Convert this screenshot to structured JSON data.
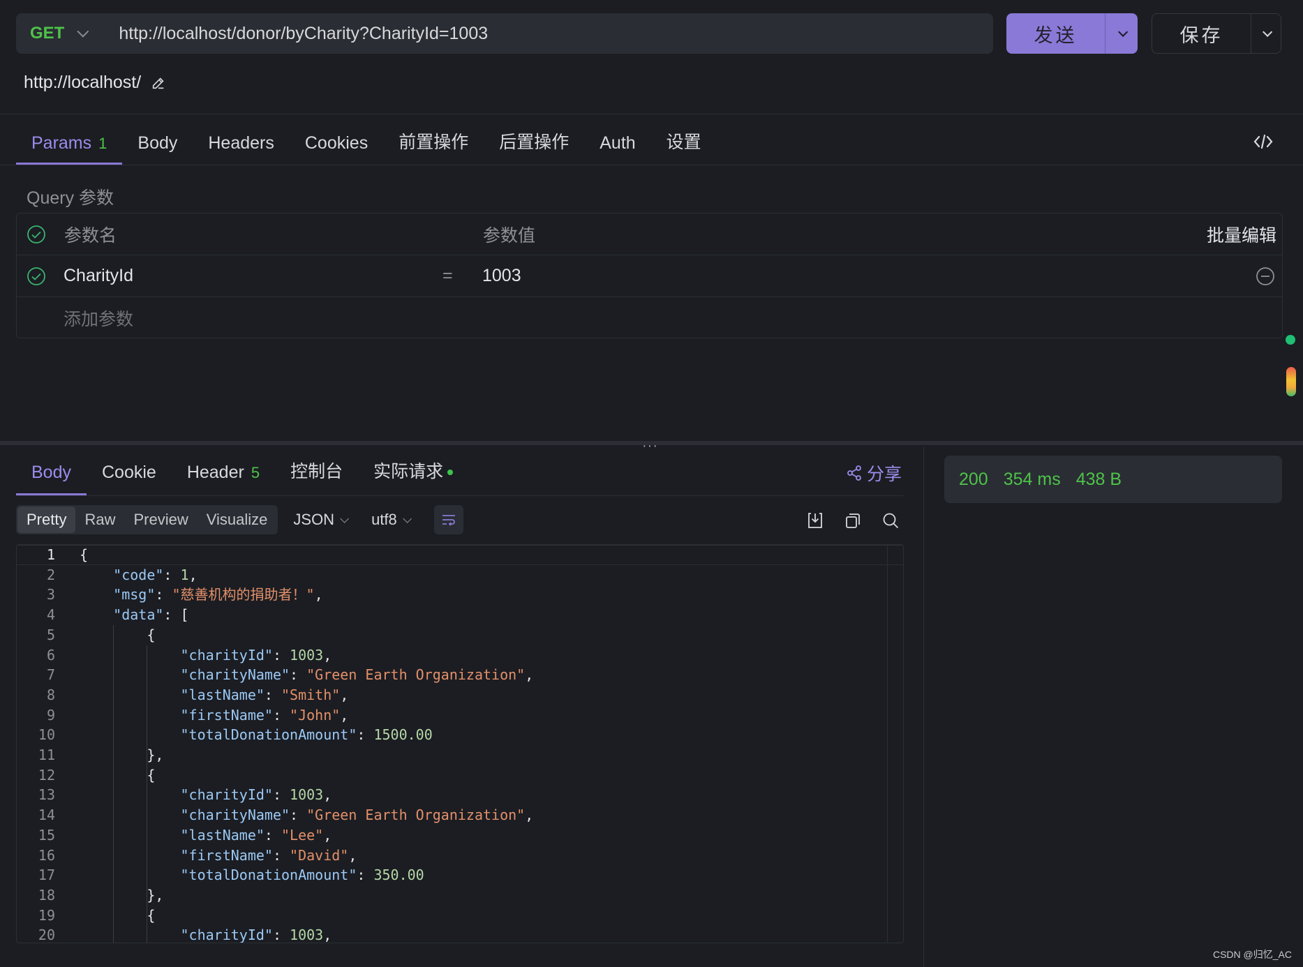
{
  "request": {
    "method": "GET",
    "url": "http://localhost/donor/byCharity?CharityId=1003",
    "send_label": "发送",
    "save_label": "保存",
    "base_url": "http://localhost/"
  },
  "request_tabs": [
    {
      "label": "Params",
      "count": "1",
      "active": true
    },
    {
      "label": "Body"
    },
    {
      "label": "Headers"
    },
    {
      "label": "Cookies"
    },
    {
      "label": "前置操作"
    },
    {
      "label": "后置操作"
    },
    {
      "label": "Auth"
    },
    {
      "label": "设置"
    }
  ],
  "params": {
    "section_title": "Query 参数",
    "col_name": "参数名",
    "col_value": "参数值",
    "bulk_edit": "批量编辑",
    "rows": [
      {
        "name": "CharityId",
        "eq": "=",
        "value": "1003"
      }
    ],
    "add_placeholder": "添加参数"
  },
  "response_tabs": [
    {
      "label": "Body",
      "active": true
    },
    {
      "label": "Cookie"
    },
    {
      "label": "Header",
      "count": "5"
    },
    {
      "label": "控制台"
    },
    {
      "label": "实际请求"
    }
  ],
  "share_label": "分享",
  "format": {
    "modes": [
      "Pretty",
      "Raw",
      "Preview",
      "Visualize"
    ],
    "selected": "Pretty",
    "type": "JSON",
    "encoding": "utf8"
  },
  "status": {
    "code": "200",
    "time": "354 ms",
    "size": "438 B"
  },
  "code_lines": [
    "{",
    "    \"code\": 1,",
    "    \"msg\": \"慈善机构的捐助者！\",",
    "    \"data\": [",
    "        {",
    "            \"charityId\": 1003,",
    "            \"charityName\": \"Green Earth Organization\",",
    "            \"lastName\": \"Smith\",",
    "            \"firstName\": \"John\",",
    "            \"totalDonationAmount\": 1500.00",
    "        },",
    "        {",
    "            \"charityId\": 1003,",
    "            \"charityName\": \"Green Earth Organization\",",
    "            \"lastName\": \"Lee\",",
    "            \"firstName\": \"David\",",
    "            \"totalDonationAmount\": 350.00",
    "        },",
    "        {",
    "            \"charityId\": 1003,"
  ],
  "watermark": "CSDN @归忆_AC",
  "colors": {
    "accent": "#8a79d6",
    "success": "#4ec24a",
    "string": "#e3906a",
    "key": "#9cc9f5",
    "number": "#b6d7a8"
  }
}
